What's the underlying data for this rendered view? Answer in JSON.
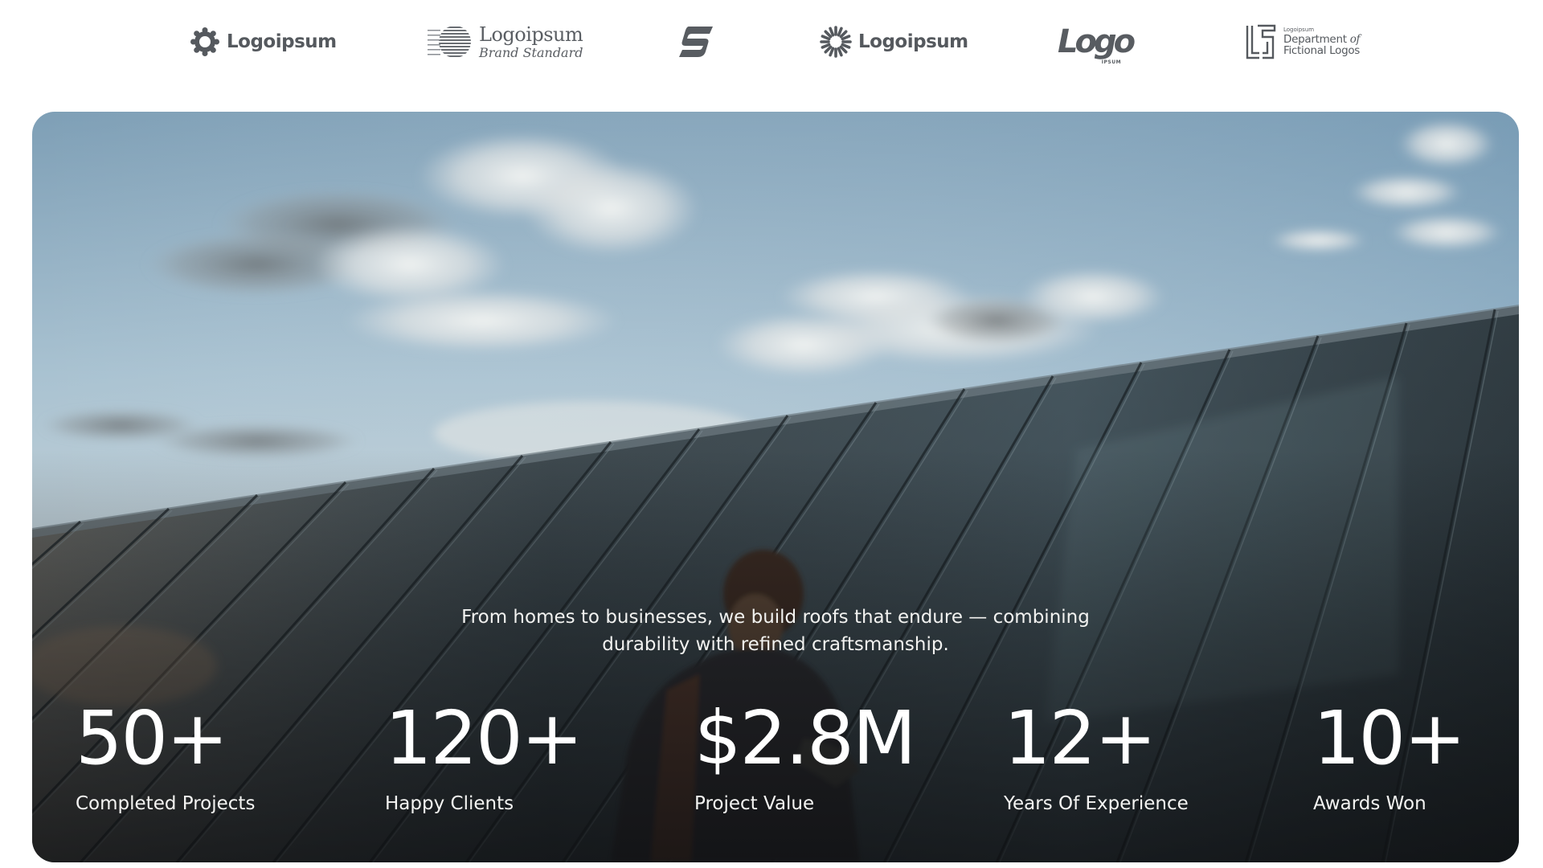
{
  "logos": [
    {
      "icon": "sun-gear-icon",
      "text": "Logoipsum"
    },
    {
      "icon": "striped-circle-icon",
      "text": "Logoipsum",
      "subtext": "Brand Standard"
    },
    {
      "icon": "s-mark-icon"
    },
    {
      "icon": "sunburst-icon",
      "text": "Logoipsum"
    },
    {
      "icon": "italic-wordmark-icon",
      "text": "Logo",
      "subtext": "IPSUM"
    },
    {
      "icon": "fl-monogram-icon",
      "tiny": "Logoipsum",
      "line1": "Department",
      "line1_italic": "of",
      "line2": "Fictional Logos"
    }
  ],
  "hero": {
    "tagline_line1": "From homes to businesses, we build roofs that endure — combining",
    "tagline_line2": "durability with refined craftsmanship."
  },
  "stats": [
    {
      "value": "50+",
      "label": "Completed Projects"
    },
    {
      "value": "120+",
      "label": "Happy Clients"
    },
    {
      "value": "$2.8M",
      "label": "Project Value"
    },
    {
      "value": "12+",
      "label": "Years Of Experience"
    },
    {
      "value": "10+",
      "label": "Awards Won"
    }
  ],
  "colors": {
    "logo_gray": "#55595e",
    "sky_top": "#8fb0c6",
    "roof_dark": "#2a3338",
    "text_white": "#ffffff"
  }
}
